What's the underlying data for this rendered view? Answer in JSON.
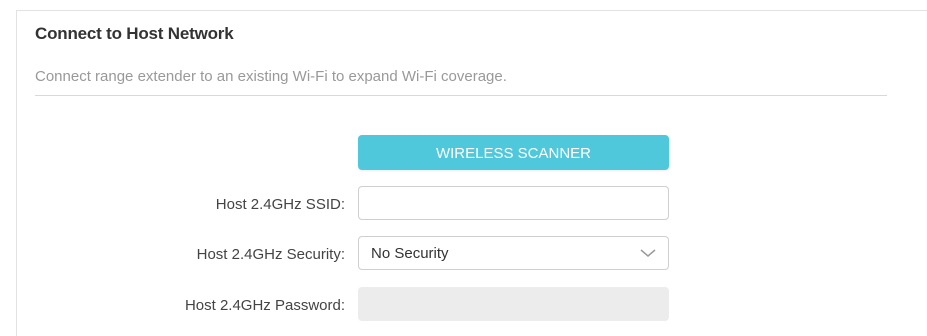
{
  "section": {
    "title": "Connect to Host Network",
    "description": "Connect range extender to an existing Wi-Fi to expand Wi-Fi coverage."
  },
  "scanner": {
    "label": "WIRELESS SCANNER"
  },
  "form": {
    "ssid": {
      "label": "Host 2.4GHz SSID:",
      "value": ""
    },
    "security": {
      "label": "Host 2.4GHz Security:",
      "selected": "No Security"
    },
    "password": {
      "label": "Host 2.4GHz Password:",
      "value": ""
    }
  },
  "colors": {
    "accent": "#4fc8dc",
    "disabled_field": "#ececec"
  },
  "icons": {
    "dropdown": "chevron-down-icon"
  }
}
